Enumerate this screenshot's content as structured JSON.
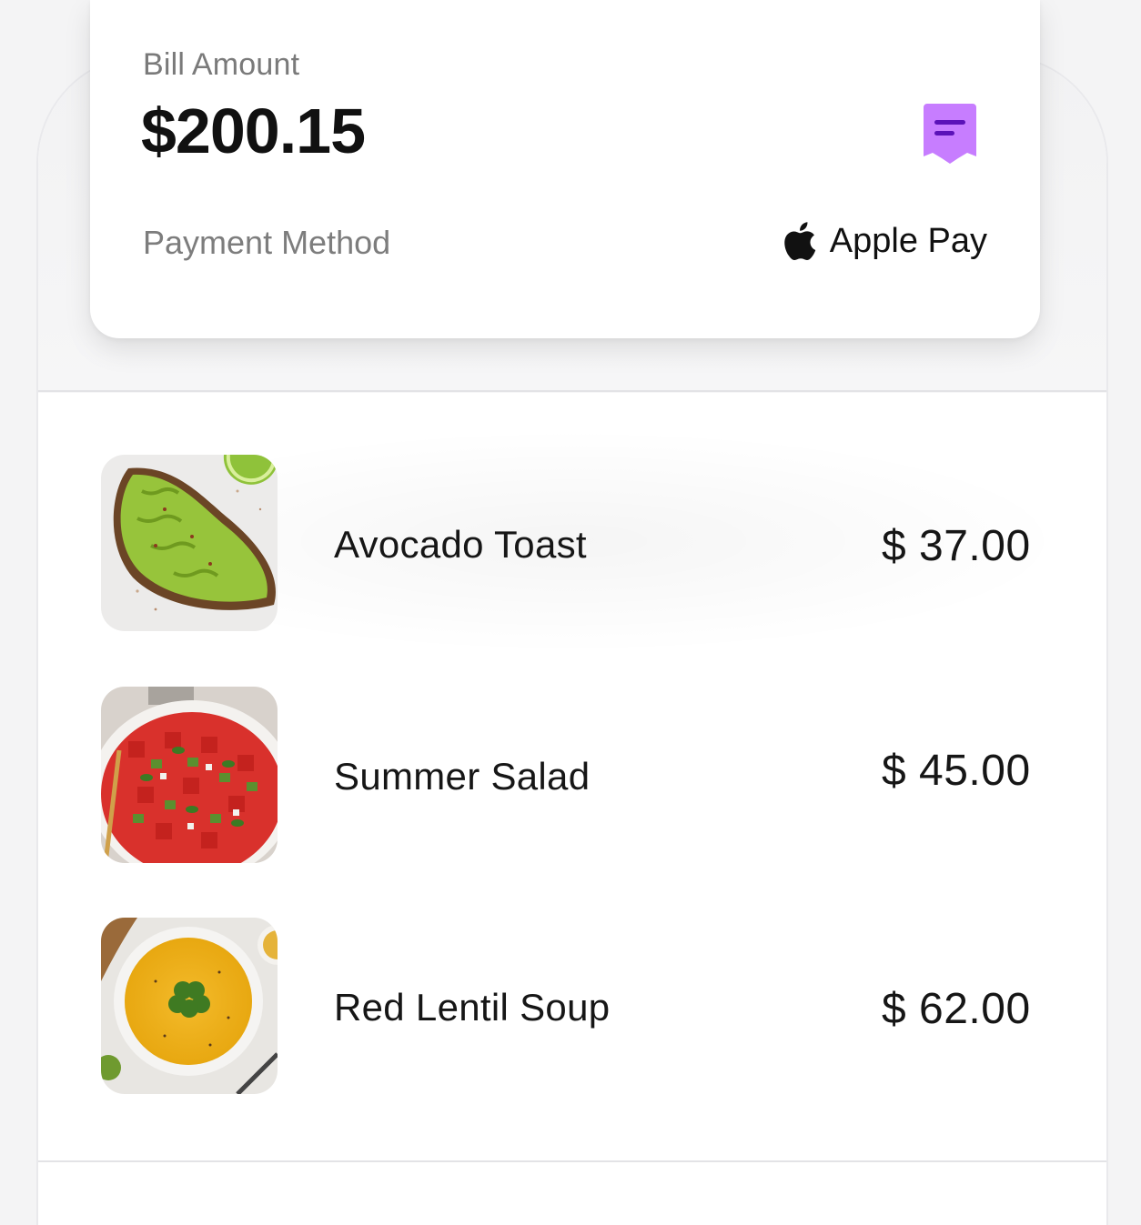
{
  "bill": {
    "label": "Bill Amount",
    "amount": "$200.15",
    "receipt_icon": "receipt-icon",
    "accent_color": "#c77dff"
  },
  "payment": {
    "label": "Payment Method",
    "method": "Apple Pay",
    "icon": "apple-icon"
  },
  "items": [
    {
      "name": "Avocado Toast",
      "price": "$ 37.00",
      "image": "avocado-toast-photo"
    },
    {
      "name": "Summer Salad",
      "price": "$ 45.00",
      "image": "summer-salad-photo"
    },
    {
      "name": "Red Lentil Soup",
      "price": "$ 62.00",
      "image": "red-lentil-soup-photo"
    }
  ]
}
